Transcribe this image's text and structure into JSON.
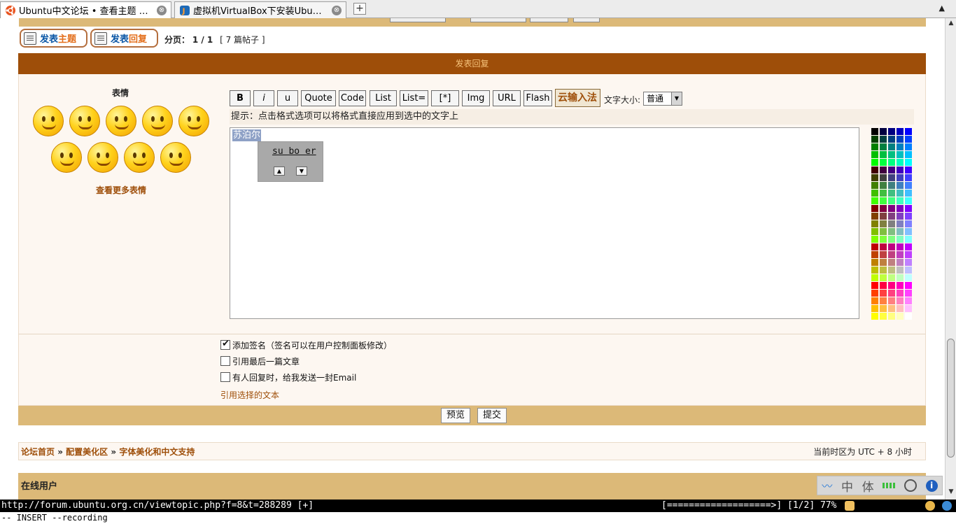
{
  "browser": {
    "tabs": [
      {
        "title": "Ubuntu中文论坛 • 查看主题 …",
        "close": "⊗"
      },
      {
        "title": "虚拟机VirtualBox下安装Ubu…",
        "close": "⊗"
      }
    ],
    "new_tab": "+",
    "tab_scroll": "▲"
  },
  "toolbar": {
    "post_topic": {
      "prefix": "发表",
      "accent": "主题"
    },
    "post_reply": {
      "prefix": "发表",
      "accent": "回复"
    },
    "pagination_label": "分页：",
    "pagination_value": "1 / 1",
    "post_count": "[ 7 篇帖子 ]"
  },
  "reply_header": "发表回复",
  "smilies": {
    "title": "表情",
    "more": "查看更多表情"
  },
  "editor_buttons": [
    "B",
    "i",
    "u",
    "Quote",
    "Code",
    "List",
    "List=",
    "[*]",
    "Img",
    "URL",
    "Flash"
  ],
  "cloud_input": "云输入法",
  "font_size_label": "文字大小:",
  "font_size_value": "普通",
  "hint": "提示：点击格式选项可以将格式直接应用到选中的文字上",
  "editor": {
    "selected_text": "苏泊尔"
  },
  "ime_popup": {
    "candidate": "su bo er",
    "up": "▲",
    "down": "▼"
  },
  "options": {
    "signature": {
      "label": "添加签名（签名可以在用户控制面板修改）",
      "checked": true
    },
    "quote_last": {
      "label": "引用最后一篇文章",
      "checked": false
    },
    "notify": {
      "label": "有人回复时，给我发送一封Email",
      "checked": false
    },
    "quote_selected": "引用选择的文本"
  },
  "buttons": {
    "preview": "预览",
    "submit": "提交"
  },
  "breadcrumb": {
    "home": "论坛首页",
    "sep": "»",
    "section": "配置美化区",
    "forum": "字体美化和中文支持"
  },
  "timezone": "当前时区为 UTC + 8 小时",
  "online_users": {
    "title": "在线用户"
  },
  "ime_toolbar": {
    "mode_cn": "中",
    "mode_width": "体",
    "info": "i"
  },
  "status": {
    "url": "http://forum.ubuntu.org.cn/viewtopic.php?f=8&t=288289 [+]",
    "progress": "[===================>] [1/2] 77%"
  },
  "command_line": "-- INSERT --recording"
}
